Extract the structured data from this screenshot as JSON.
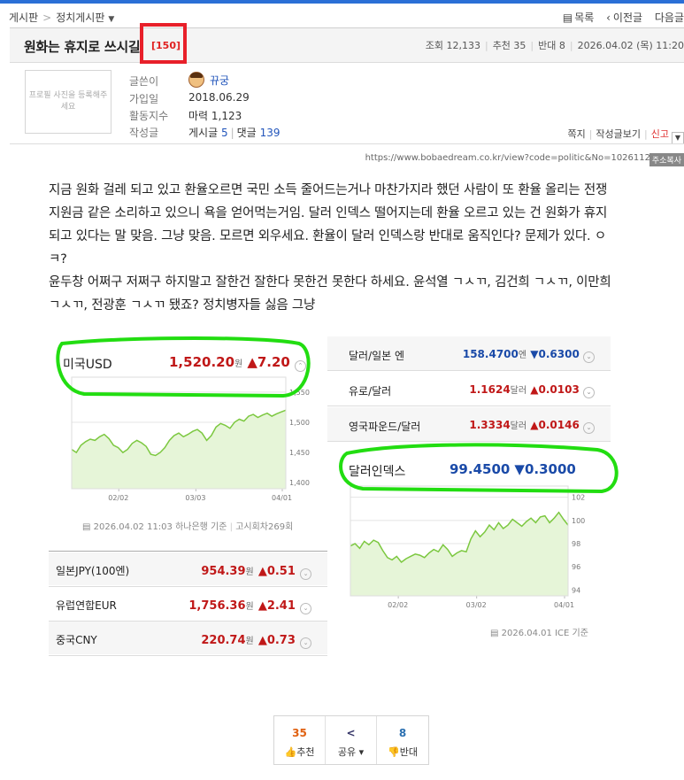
{
  "breadcrumb": {
    "board": "게시판",
    "sub": "정치게시판"
  },
  "topnav": {
    "list": "목록",
    "prev": "이전글",
    "next": "다음글"
  },
  "post": {
    "title": "원화는 휴지로 쓰시길",
    "comment_count": "[150]"
  },
  "meta": {
    "views": "조회 12,133",
    "recommend": "추천 35",
    "oppose": "반대 8",
    "datetime": "2026.04.02 (목) 11:20"
  },
  "avatar_placeholder": "프로필 사진을 등록해주세요",
  "author": {
    "labels": [
      "글쓴이",
      "가입일",
      "활동지수",
      "작성글"
    ],
    "name": "뀨궁",
    "joined": "2018.06.29",
    "activity": "마력 1,123",
    "posts_label": "게시글",
    "posts": "5",
    "comments_label": "댓글",
    "comments": "139"
  },
  "actions": {
    "message": "쪽지",
    "view_posts": "작성글보기",
    "report": "신고"
  },
  "url": "https://www.bobaedream.co.kr/view?code=politic&No=1026112",
  "copy_label": "주소복사",
  "body": [
    "지금 원화 걸레 되고 있고 환율오르면 국민 소득 줄어드는거나 마찬가지라 했던 사람이 또 환율 올리는 전쟁",
    "지원금 같은 소리하고 있으니 욕을 얻어먹는거임. 달러 인덱스 떨어지는데 환율 오르고 있는 건 원화가 휴지",
    "되고 있다는 말 맞음. 그냥 맞음. 모르면 외우세요. 환율이 달러 인덱스랑 반대로 움직인다? 문제가 있다. ㅇ",
    "ㅋ?",
    "윤두창 어쩌구 저쩌구 하지말고 잘한건 잘한다 못한건 못한다 하세요. 윤석열 ㄱㅅㄲ, 김건희 ㄱㅅㄲ, 이만희",
    "ㄱㅅㄲ, 전광훈 ㄱㅅㄲ 됐죠? 정치병자들 싫음 그냥"
  ],
  "usd": {
    "name": "미국USD",
    "value": "1,520.20",
    "unit": "원",
    "change": "▲7.20"
  },
  "usd_footer": "2026.04.02 11:03 하나은행 기준",
  "usd_footer2": "고시회차269회",
  "left_rates": [
    {
      "name": "일본JPY(100엔)",
      "value": "954.39",
      "unit": "원",
      "change": "▲0.51"
    },
    {
      "name": "유럽연합EUR",
      "value": "1,756.36",
      "unit": "원",
      "change": "▲2.41"
    },
    {
      "name": "중국CNY",
      "value": "220.74",
      "unit": "원",
      "change": "▲0.73"
    }
  ],
  "right_rates": [
    {
      "name": "달러/일본 엔",
      "value": "158.4700",
      "unit": "엔",
      "change": "▼0.6300",
      "color": "#1a4aa8"
    },
    {
      "name": "유로/달러",
      "value": "1.1624",
      "unit": "달러",
      "change": "▲0.0103",
      "color": "#c01818"
    },
    {
      "name": "영국파운드/달러",
      "value": "1.3334",
      "unit": "달러",
      "change": "▲0.0146",
      "color": "#c01818"
    }
  ],
  "dxy": {
    "name": "달러인덱스",
    "value": "99.4500",
    "change": "▼0.3000"
  },
  "dxy_footer": "2026.04.01 ICE 기준",
  "chart_data": [
    {
      "type": "area",
      "title": "미국USD",
      "x": [
        "02/02",
        "03/03",
        "04/01"
      ],
      "yticks": [
        1400,
        1450,
        1500,
        1550
      ],
      "ylim": [
        1390,
        1560
      ],
      "values": [
        1455,
        1450,
        1462,
        1468,
        1472,
        1470,
        1476,
        1480,
        1473,
        1462,
        1458,
        1450,
        1455,
        1465,
        1470,
        1466,
        1460,
        1447,
        1445,
        1450,
        1458,
        1470,
        1478,
        1482,
        1476,
        1480,
        1485,
        1488,
        1482,
        1470,
        1478,
        1492,
        1498,
        1495,
        1490,
        1500,
        1505,
        1502,
        1510,
        1513,
        1508,
        1512,
        1515,
        1510,
        1514,
        1517,
        1520
      ]
    },
    {
      "type": "area",
      "title": "달러인덱스",
      "x": [
        "02/02",
        "03/02",
        "04/01"
      ],
      "yticks": [
        94,
        96,
        98,
        100,
        102
      ],
      "ylim": [
        93.5,
        102.2
      ],
      "values": [
        97.8,
        98.0,
        97.6,
        98.2,
        97.9,
        98.3,
        98.1,
        97.4,
        96.8,
        96.6,
        96.9,
        96.4,
        96.7,
        96.9,
        97.1,
        97.0,
        96.8,
        97.2,
        97.5,
        97.3,
        97.9,
        97.5,
        96.9,
        97.2,
        97.4,
        97.3,
        98.4,
        99.1,
        98.6,
        99.0,
        99.6,
        99.2,
        99.8,
        99.3,
        99.6,
        100.1,
        99.8,
        99.5,
        99.9,
        100.2,
        99.8,
        100.3,
        100.4,
        99.8,
        100.2,
        100.7,
        100.1,
        99.6
      ]
    }
  ],
  "votes": {
    "up": "35",
    "up_label": "추천",
    "share_label": "공유",
    "down": "8",
    "down_label": "반대"
  }
}
